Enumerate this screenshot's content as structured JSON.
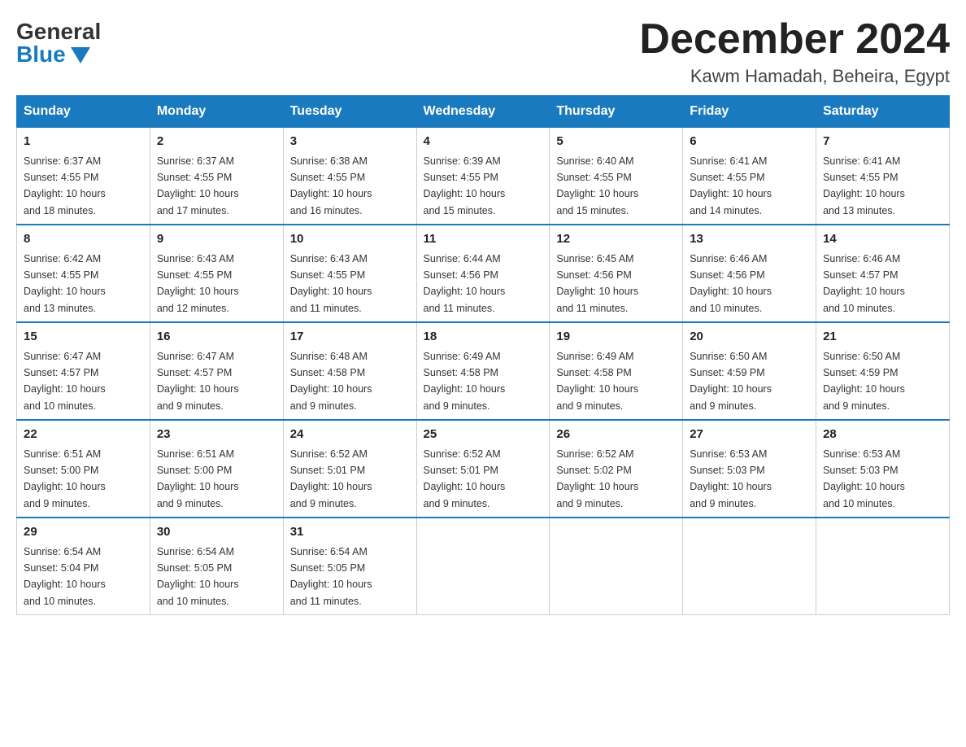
{
  "header": {
    "logo_general": "General",
    "logo_blue": "Blue",
    "month_title": "December 2024",
    "location": "Kawm Hamadah, Beheira, Egypt"
  },
  "days_of_week": [
    "Sunday",
    "Monday",
    "Tuesday",
    "Wednesday",
    "Thursday",
    "Friday",
    "Saturday"
  ],
  "weeks": [
    [
      {
        "day": "1",
        "sunrise": "6:37 AM",
        "sunset": "4:55 PM",
        "daylight": "10 hours and 18 minutes."
      },
      {
        "day": "2",
        "sunrise": "6:37 AM",
        "sunset": "4:55 PM",
        "daylight": "10 hours and 17 minutes."
      },
      {
        "day": "3",
        "sunrise": "6:38 AM",
        "sunset": "4:55 PM",
        "daylight": "10 hours and 16 minutes."
      },
      {
        "day": "4",
        "sunrise": "6:39 AM",
        "sunset": "4:55 PM",
        "daylight": "10 hours and 15 minutes."
      },
      {
        "day": "5",
        "sunrise": "6:40 AM",
        "sunset": "4:55 PM",
        "daylight": "10 hours and 15 minutes."
      },
      {
        "day": "6",
        "sunrise": "6:41 AM",
        "sunset": "4:55 PM",
        "daylight": "10 hours and 14 minutes."
      },
      {
        "day": "7",
        "sunrise": "6:41 AM",
        "sunset": "4:55 PM",
        "daylight": "10 hours and 13 minutes."
      }
    ],
    [
      {
        "day": "8",
        "sunrise": "6:42 AM",
        "sunset": "4:55 PM",
        "daylight": "10 hours and 13 minutes."
      },
      {
        "day": "9",
        "sunrise": "6:43 AM",
        "sunset": "4:55 PM",
        "daylight": "10 hours and 12 minutes."
      },
      {
        "day": "10",
        "sunrise": "6:43 AM",
        "sunset": "4:55 PM",
        "daylight": "10 hours and 11 minutes."
      },
      {
        "day": "11",
        "sunrise": "6:44 AM",
        "sunset": "4:56 PM",
        "daylight": "10 hours and 11 minutes."
      },
      {
        "day": "12",
        "sunrise": "6:45 AM",
        "sunset": "4:56 PM",
        "daylight": "10 hours and 11 minutes."
      },
      {
        "day": "13",
        "sunrise": "6:46 AM",
        "sunset": "4:56 PM",
        "daylight": "10 hours and 10 minutes."
      },
      {
        "day": "14",
        "sunrise": "6:46 AM",
        "sunset": "4:57 PM",
        "daylight": "10 hours and 10 minutes."
      }
    ],
    [
      {
        "day": "15",
        "sunrise": "6:47 AM",
        "sunset": "4:57 PM",
        "daylight": "10 hours and 10 minutes."
      },
      {
        "day": "16",
        "sunrise": "6:47 AM",
        "sunset": "4:57 PM",
        "daylight": "10 hours and 9 minutes."
      },
      {
        "day": "17",
        "sunrise": "6:48 AM",
        "sunset": "4:58 PM",
        "daylight": "10 hours and 9 minutes."
      },
      {
        "day": "18",
        "sunrise": "6:49 AM",
        "sunset": "4:58 PM",
        "daylight": "10 hours and 9 minutes."
      },
      {
        "day": "19",
        "sunrise": "6:49 AM",
        "sunset": "4:58 PM",
        "daylight": "10 hours and 9 minutes."
      },
      {
        "day": "20",
        "sunrise": "6:50 AM",
        "sunset": "4:59 PM",
        "daylight": "10 hours and 9 minutes."
      },
      {
        "day": "21",
        "sunrise": "6:50 AM",
        "sunset": "4:59 PM",
        "daylight": "10 hours and 9 minutes."
      }
    ],
    [
      {
        "day": "22",
        "sunrise": "6:51 AM",
        "sunset": "5:00 PM",
        "daylight": "10 hours and 9 minutes."
      },
      {
        "day": "23",
        "sunrise": "6:51 AM",
        "sunset": "5:00 PM",
        "daylight": "10 hours and 9 minutes."
      },
      {
        "day": "24",
        "sunrise": "6:52 AM",
        "sunset": "5:01 PM",
        "daylight": "10 hours and 9 minutes."
      },
      {
        "day": "25",
        "sunrise": "6:52 AM",
        "sunset": "5:01 PM",
        "daylight": "10 hours and 9 minutes."
      },
      {
        "day": "26",
        "sunrise": "6:52 AM",
        "sunset": "5:02 PM",
        "daylight": "10 hours and 9 minutes."
      },
      {
        "day": "27",
        "sunrise": "6:53 AM",
        "sunset": "5:03 PM",
        "daylight": "10 hours and 9 minutes."
      },
      {
        "day": "28",
        "sunrise": "6:53 AM",
        "sunset": "5:03 PM",
        "daylight": "10 hours and 10 minutes."
      }
    ],
    [
      {
        "day": "29",
        "sunrise": "6:54 AM",
        "sunset": "5:04 PM",
        "daylight": "10 hours and 10 minutes."
      },
      {
        "day": "30",
        "sunrise": "6:54 AM",
        "sunset": "5:05 PM",
        "daylight": "10 hours and 10 minutes."
      },
      {
        "day": "31",
        "sunrise": "6:54 AM",
        "sunset": "5:05 PM",
        "daylight": "10 hours and 11 minutes."
      },
      null,
      null,
      null,
      null
    ]
  ],
  "labels": {
    "sunrise": "Sunrise:",
    "sunset": "Sunset:",
    "daylight": "Daylight:"
  }
}
